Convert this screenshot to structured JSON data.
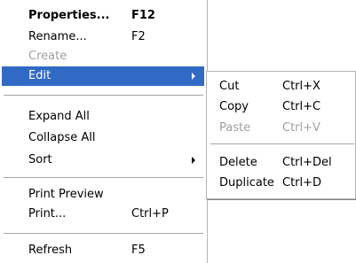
{
  "main_menu": {
    "items": [
      {
        "label": "Properties...",
        "shortcut": "F12"
      },
      {
        "label": "Rename...",
        "shortcut": "F2"
      },
      {
        "label": "Create",
        "shortcut": ""
      },
      {
        "label": "Edit",
        "shortcut": ""
      },
      {
        "label": "Expand All",
        "shortcut": ""
      },
      {
        "label": "Collapse All",
        "shortcut": ""
      },
      {
        "label": "Sort",
        "shortcut": ""
      },
      {
        "label": "Print Preview",
        "shortcut": ""
      },
      {
        "label": "Print...",
        "shortcut": "Ctrl+P"
      },
      {
        "label": "Refresh",
        "shortcut": "F5"
      }
    ]
  },
  "edit_submenu": {
    "items": [
      {
        "label": "Cut",
        "shortcut": "Ctrl+X"
      },
      {
        "label": "Copy",
        "shortcut": "Ctrl+C"
      },
      {
        "label": "Paste",
        "shortcut": "Ctrl+V"
      },
      {
        "label": "Delete",
        "shortcut": "Ctrl+Del"
      },
      {
        "label": "Duplicate",
        "shortcut": "Ctrl+D"
      }
    ]
  },
  "colors": {
    "highlight": "#316ac5",
    "disabled_text": "#a0a0a0",
    "separator": "#a6a6a6"
  }
}
